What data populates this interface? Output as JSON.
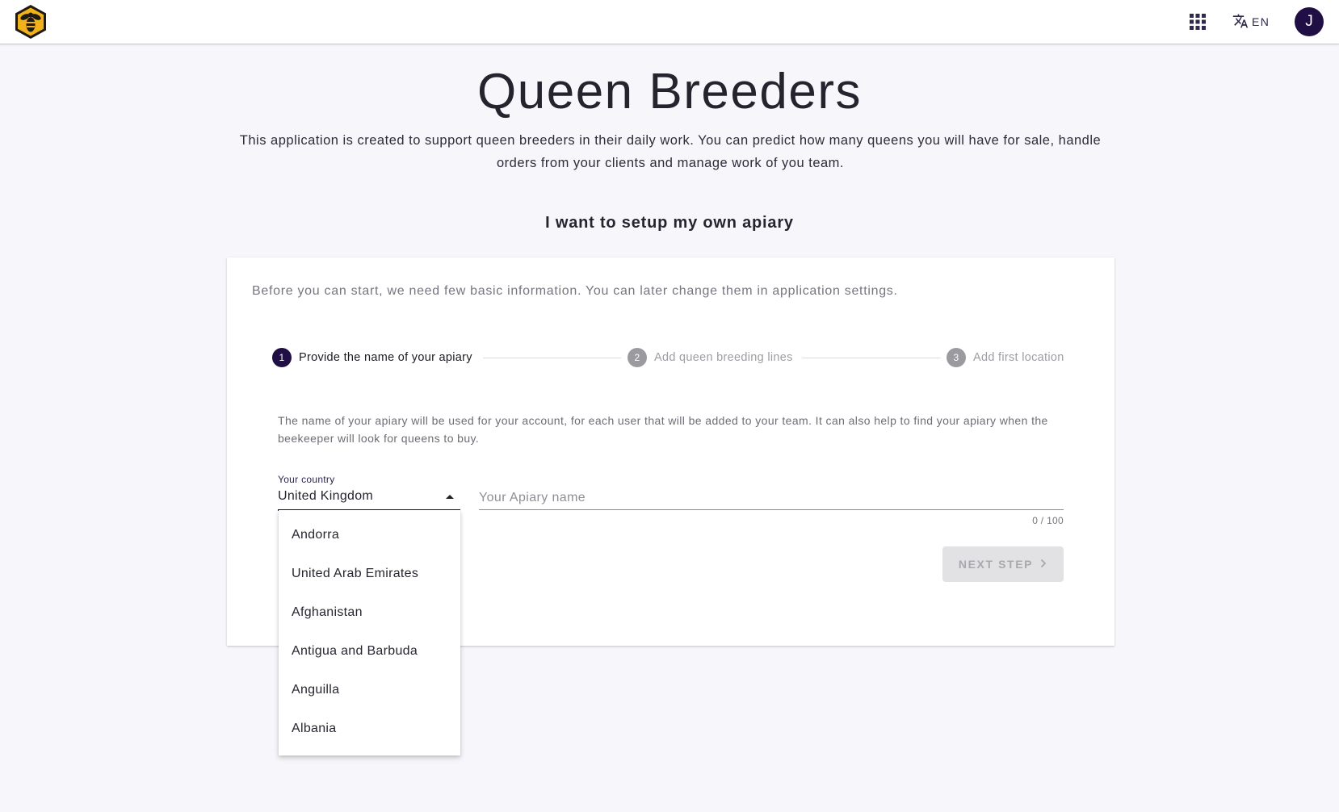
{
  "header": {
    "language_code": "EN",
    "avatar_initial": "J"
  },
  "hero": {
    "title": "Queen Breeders",
    "description": "This application is created to support queen breeders in their daily work. You can predict how many queens you will have for sale, handle orders from your clients and manage work of you team."
  },
  "setup": {
    "heading": "I want to setup my own apiary",
    "card_intro": "Before you can start, we need few basic information. You can later change them in application settings.",
    "steps": [
      {
        "number": "1",
        "label": "Provide the name of your apiary",
        "active": true
      },
      {
        "number": "2",
        "label": "Add queen breeding lines",
        "active": false
      },
      {
        "number": "3",
        "label": "Add first location",
        "active": false
      }
    ],
    "step_description": "The name of your apiary will be used for your account, for each user that will be added to your team. It can also help to find your apiary when the beekeeper will look for queens to buy.",
    "country": {
      "label": "Your country",
      "selected": "United Kingdom",
      "options": [
        "Andorra",
        "United Arab Emirates",
        "Afghanistan",
        "Antigua and Barbuda",
        "Anguilla",
        "Albania"
      ]
    },
    "apiary_name": {
      "value": "",
      "placeholder": "Your Apiary name",
      "char_count": "0 / 100"
    },
    "next_button": "NEXT STEP"
  },
  "colors": {
    "primary": "#1f0f45",
    "logo_gold": "#f2b21a",
    "background": "#f7f6fb"
  },
  "icons": {
    "logo": "bee-hexagon-logo",
    "apps": "apps-grid-icon",
    "translate": "translate-icon",
    "caret": "caret-up-icon",
    "next": "chevron-right-icon"
  }
}
